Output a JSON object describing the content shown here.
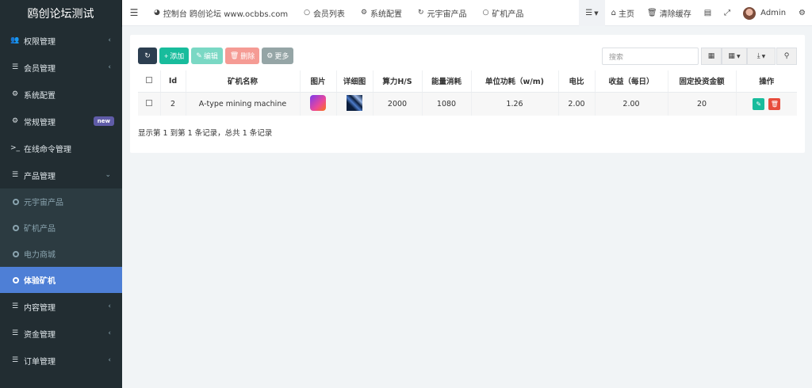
{
  "brand": "鸥创论坛测试",
  "sidebar": {
    "items": [
      {
        "label": "权限管理",
        "icon": "users-icon"
      },
      {
        "label": "会员管理",
        "icon": "list-icon"
      },
      {
        "label": "系统配置",
        "icon": "gear-icon"
      },
      {
        "label": "常规管理",
        "icon": "cogs-icon",
        "badge": "new"
      },
      {
        "label": "在线命令管理",
        "icon": "terminal-icon"
      },
      {
        "label": "产品管理",
        "icon": "list-icon"
      }
    ],
    "sub_items": [
      {
        "label": "元宇宙产品"
      },
      {
        "label": "矿机产品"
      },
      {
        "label": "电力商城"
      },
      {
        "label": "体验矿机"
      }
    ],
    "bottom_items": [
      {
        "label": "内容管理",
        "icon": "list-icon"
      },
      {
        "label": "资金管理",
        "icon": "list-icon"
      },
      {
        "label": "订单管理",
        "icon": "list-icon"
      }
    ]
  },
  "topbar": {
    "tabs": [
      {
        "label": "控制台 鸥创论坛 www.ocbbs.com",
        "icon": "dashboard-icon"
      },
      {
        "label": "会员列表",
        "icon": "circle-icon"
      },
      {
        "label": "系统配置",
        "icon": "gear-icon"
      },
      {
        "label": "元宇宙产品",
        "icon": "refresh-icon"
      },
      {
        "label": "矿机产品",
        "icon": "circle-icon"
      }
    ],
    "home_label": "主页",
    "clear_cache_label": "清除缓存",
    "user_name": "Admin"
  },
  "toolbar": {
    "add_label": "添加",
    "edit_label": "编辑",
    "delete_label": "删除",
    "more_label": "更多",
    "search_placeholder": "搜索"
  },
  "table": {
    "headers": [
      "Id",
      "矿机名称",
      "图片",
      "详细图",
      "算力H/S",
      "能量消耗",
      "单位功耗（w/m)",
      "电比",
      "收益（每日）",
      "固定投资金额",
      "操作"
    ],
    "rows": [
      {
        "id": "2",
        "name": "A-type mining machine",
        "hashrate": "2000",
        "energy": "1080",
        "unit_power": "1.26",
        "ratio": "2.00",
        "daily_income": "2.00",
        "fixed_invest": "20"
      }
    ]
  },
  "pagination_info": "显示第 1 到第 1 条记录，总共 1 条记录"
}
